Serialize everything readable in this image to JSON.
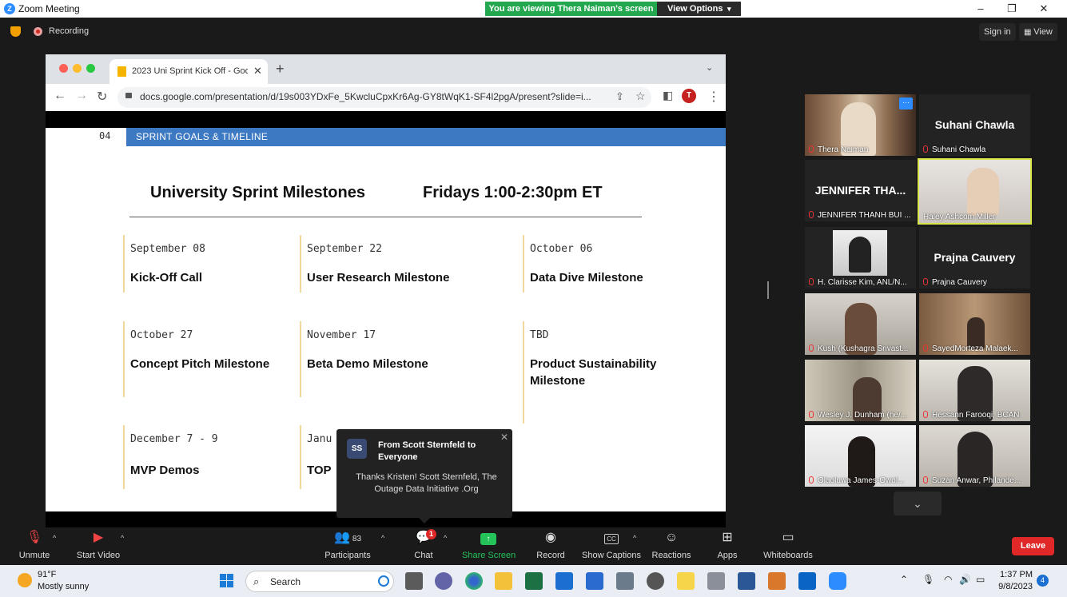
{
  "window": {
    "app_title": "Zoom Meeting",
    "viewing_banner": "You are viewing Thera Naiman's screen",
    "view_options": "View Options",
    "minimize": "–",
    "restore": "❐",
    "close": "✕"
  },
  "meeting_bar": {
    "recording": "Recording",
    "sign_in": "Sign in",
    "view": "View"
  },
  "browser": {
    "tab_title": "2023 Uni Sprint Kick Off - Goo",
    "url": "docs.google.com/presentation/d/19s003YDxFe_5KwcluCpxKr6Ag-GY8tWqK1-SF4l2pgA/present?slide=i...",
    "profile_initial": "T"
  },
  "slide": {
    "number": "04",
    "section": "SPRINT GOALS & TIMELINE",
    "heading_left": "University Sprint Milestones",
    "heading_right": "Fridays 1:00-2:30pm ET",
    "milestones": [
      {
        "date": "September 08",
        "name": "Kick-Off Call"
      },
      {
        "date": "September 22",
        "name": "User Research Milestone"
      },
      {
        "date": "October 06",
        "name": "Data Dive Milestone"
      },
      {
        "date": "October 27",
        "name": "Concept Pitch Milestone"
      },
      {
        "date": "November 17",
        "name": "Beta Demo Milestone"
      },
      {
        "date": "TBD",
        "name": "Product Sustainability Milestone"
      },
      {
        "date": "December 7 - 9",
        "name": "MVP Demos"
      },
      {
        "date": "Janu",
        "name": "TOP"
      }
    ]
  },
  "chat_toast": {
    "avatar": "SS",
    "from": "From Scott Sternfeld to Everyone",
    "message": "Thanks Kristen! Scott Sternfeld, The Outage Data Initiative .Org"
  },
  "participants": [
    {
      "name": "Thera Naiman",
      "display_name": "",
      "video": true
    },
    {
      "name": "Suhani Chawla",
      "display_name": "Suhani Chawla",
      "video": false
    },
    {
      "name": "JENNIFER THANH BUI ...",
      "display_name": "JENNIFER  THA...",
      "video": false
    },
    {
      "name": "Haley Ashcom Miller",
      "display_name": "",
      "video": true
    },
    {
      "name": "H. Clarisse Kim, ANL/N...",
      "display_name": "",
      "video": true
    },
    {
      "name": "Prajna Cauvery",
      "display_name": "Prajna Cauvery",
      "video": false
    },
    {
      "name": "Kush (Kushagra Srivast...",
      "display_name": "",
      "video": true
    },
    {
      "name": "SayedMorteza Malaek...",
      "display_name": "",
      "video": true
    },
    {
      "name": "Wesley J. Dunham (he/...",
      "display_name": "",
      "video": true
    },
    {
      "name": "Hessann Farooqi, BCAN",
      "display_name": "",
      "video": true
    },
    {
      "name": "Olaoluwa James-Owol...",
      "display_name": "",
      "video": true
    },
    {
      "name": "Suzan Anwar, Philande...",
      "display_name": "",
      "video": true
    }
  ],
  "toolbar": {
    "unmute": "Unmute",
    "start_video": "Start Video",
    "participants": "Participants",
    "participants_count": "83",
    "chat": "Chat",
    "chat_badge": "1",
    "share_screen": "Share Screen",
    "record": "Record",
    "show_captions": "Show Captions",
    "reactions": "Reactions",
    "apps": "Apps",
    "whiteboards": "Whiteboards",
    "leave": "Leave",
    "cc": "CC"
  },
  "taskbar": {
    "temperature": "91°F",
    "weather": "Mostly sunny",
    "search": "Search",
    "time": "1:37 PM",
    "date": "9/8/2023",
    "notifications": "4"
  },
  "colors": {
    "zoom_blue": "#2D8CFF",
    "viewing_green": "#23a850",
    "leave_red": "#e02828",
    "slide_section_blue": "#3d78c2",
    "milestone_bar": "#f0d79b",
    "active_speaker": "#d9e64a"
  }
}
